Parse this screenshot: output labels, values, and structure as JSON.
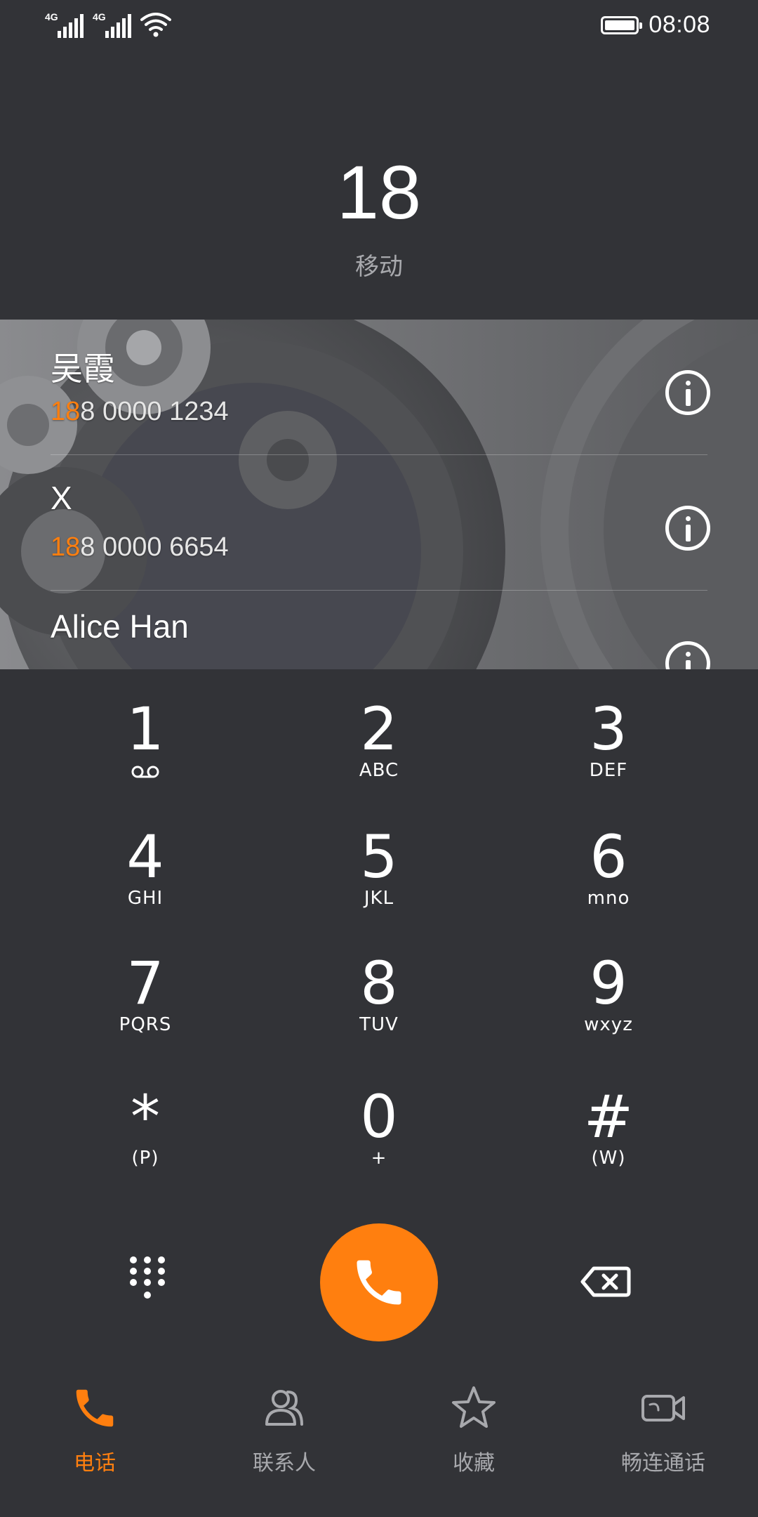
{
  "status_bar": {
    "network_1": "4G",
    "network_2": "4G",
    "time": "08:08"
  },
  "dialer": {
    "dialed_number": "18",
    "carrier": "移动"
  },
  "results": [
    {
      "name": "吴霞",
      "phone_match": "18",
      "phone_rest": "8 0000 1234"
    },
    {
      "name": "X",
      "phone_match": "18",
      "phone_rest": "8 0000 6654"
    },
    {
      "name": "Alice Han",
      "phone_match": "",
      "phone_rest": ""
    }
  ],
  "keypad": [
    {
      "digit": "1",
      "letters": "voicemail-icon"
    },
    {
      "digit": "2",
      "letters": "ABC"
    },
    {
      "digit": "3",
      "letters": "DEF"
    },
    {
      "digit": "4",
      "letters": "GHI"
    },
    {
      "digit": "5",
      "letters": "JKL"
    },
    {
      "digit": "6",
      "letters": "mno"
    },
    {
      "digit": "7",
      "letters": "PQRS"
    },
    {
      "digit": "8",
      "letters": "TUV"
    },
    {
      "digit": "9",
      "letters": "wxyz"
    },
    {
      "digit": "*",
      "letters": "(P)"
    },
    {
      "digit": "0",
      "letters": "+"
    },
    {
      "digit": "#",
      "letters": "(W)"
    }
  ],
  "tabs": [
    {
      "label": "电话",
      "icon": "phone-icon",
      "active": true
    },
    {
      "label": "联系人",
      "icon": "contacts-icon",
      "active": false
    },
    {
      "label": "收藏",
      "icon": "star-icon",
      "active": false
    },
    {
      "label": "畅连通话",
      "icon": "video-call-icon",
      "active": false
    }
  ],
  "colors": {
    "background": "#323337",
    "accent": "#ff7f0f",
    "muted_text": "#a8a9ad"
  }
}
